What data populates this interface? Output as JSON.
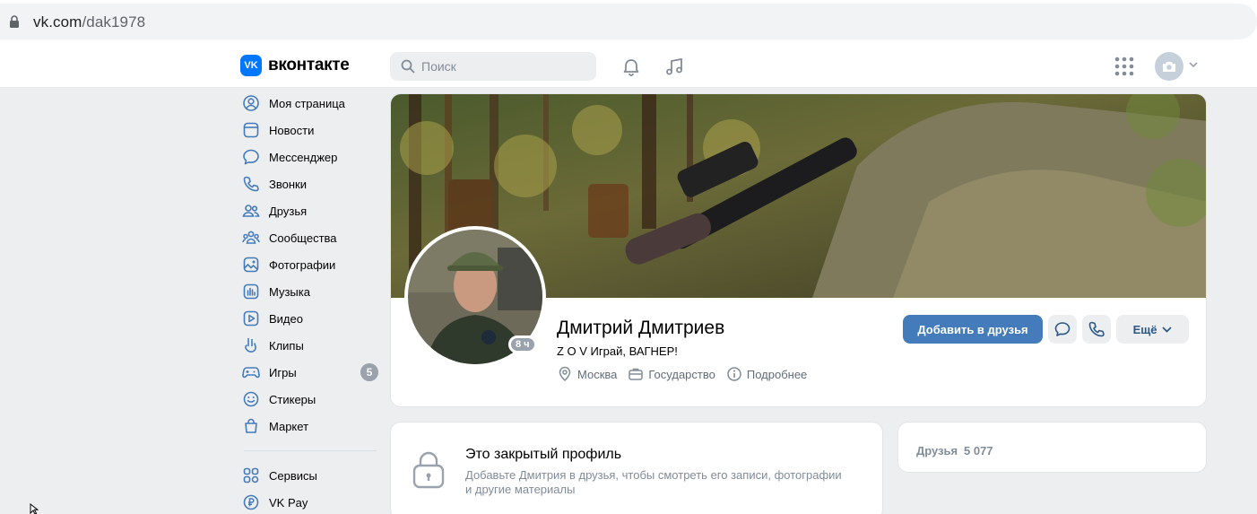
{
  "browser": {
    "url_host": "vk.com",
    "url_path": "/dak1978"
  },
  "header": {
    "logo_text": "вконтакте",
    "logo_mark": "VK",
    "search_placeholder": "Поиск"
  },
  "nav": {
    "items": [
      {
        "label": "Моя страница",
        "icon": "user-circle-icon"
      },
      {
        "label": "Новости",
        "icon": "newsfeed-icon"
      },
      {
        "label": "Мессенджер",
        "icon": "message-icon"
      },
      {
        "label": "Звонки",
        "icon": "phone-icon"
      },
      {
        "label": "Друзья",
        "icon": "friends-icon"
      },
      {
        "label": "Сообщества",
        "icon": "communities-icon"
      },
      {
        "label": "Фотографии",
        "icon": "photos-icon"
      },
      {
        "label": "Музыка",
        "icon": "music-icon"
      },
      {
        "label": "Видео",
        "icon": "video-icon"
      },
      {
        "label": "Клипы",
        "icon": "clips-icon"
      },
      {
        "label": "Игры",
        "icon": "games-icon",
        "badge": "5"
      },
      {
        "label": "Стикеры",
        "icon": "stickers-icon"
      },
      {
        "label": "Маркет",
        "icon": "market-icon"
      }
    ],
    "secondary": [
      {
        "label": "Сервисы",
        "icon": "services-icon"
      },
      {
        "label": "VK Pay",
        "icon": "vkpay-icon"
      }
    ]
  },
  "profile": {
    "name": "Дмитрий Дмитриев",
    "status": "Z O V Играй, ВАГНЕР!",
    "online": "8 ч",
    "city": "Москва",
    "work": "Государство",
    "details": "Подробнее",
    "add_friend": "Добавить в друзья",
    "more": "Ещё"
  },
  "closed": {
    "title": "Это закрытый профиль",
    "text": "Добавьте Дмитрия в друзья, чтобы смотреть его записи, фотографии и другие материалы"
  },
  "friends": {
    "label": "Друзья",
    "count": "5 077"
  },
  "colors": {
    "accent": "#447bba",
    "brand": "#0077ff",
    "nav_icon": "#447bba"
  }
}
